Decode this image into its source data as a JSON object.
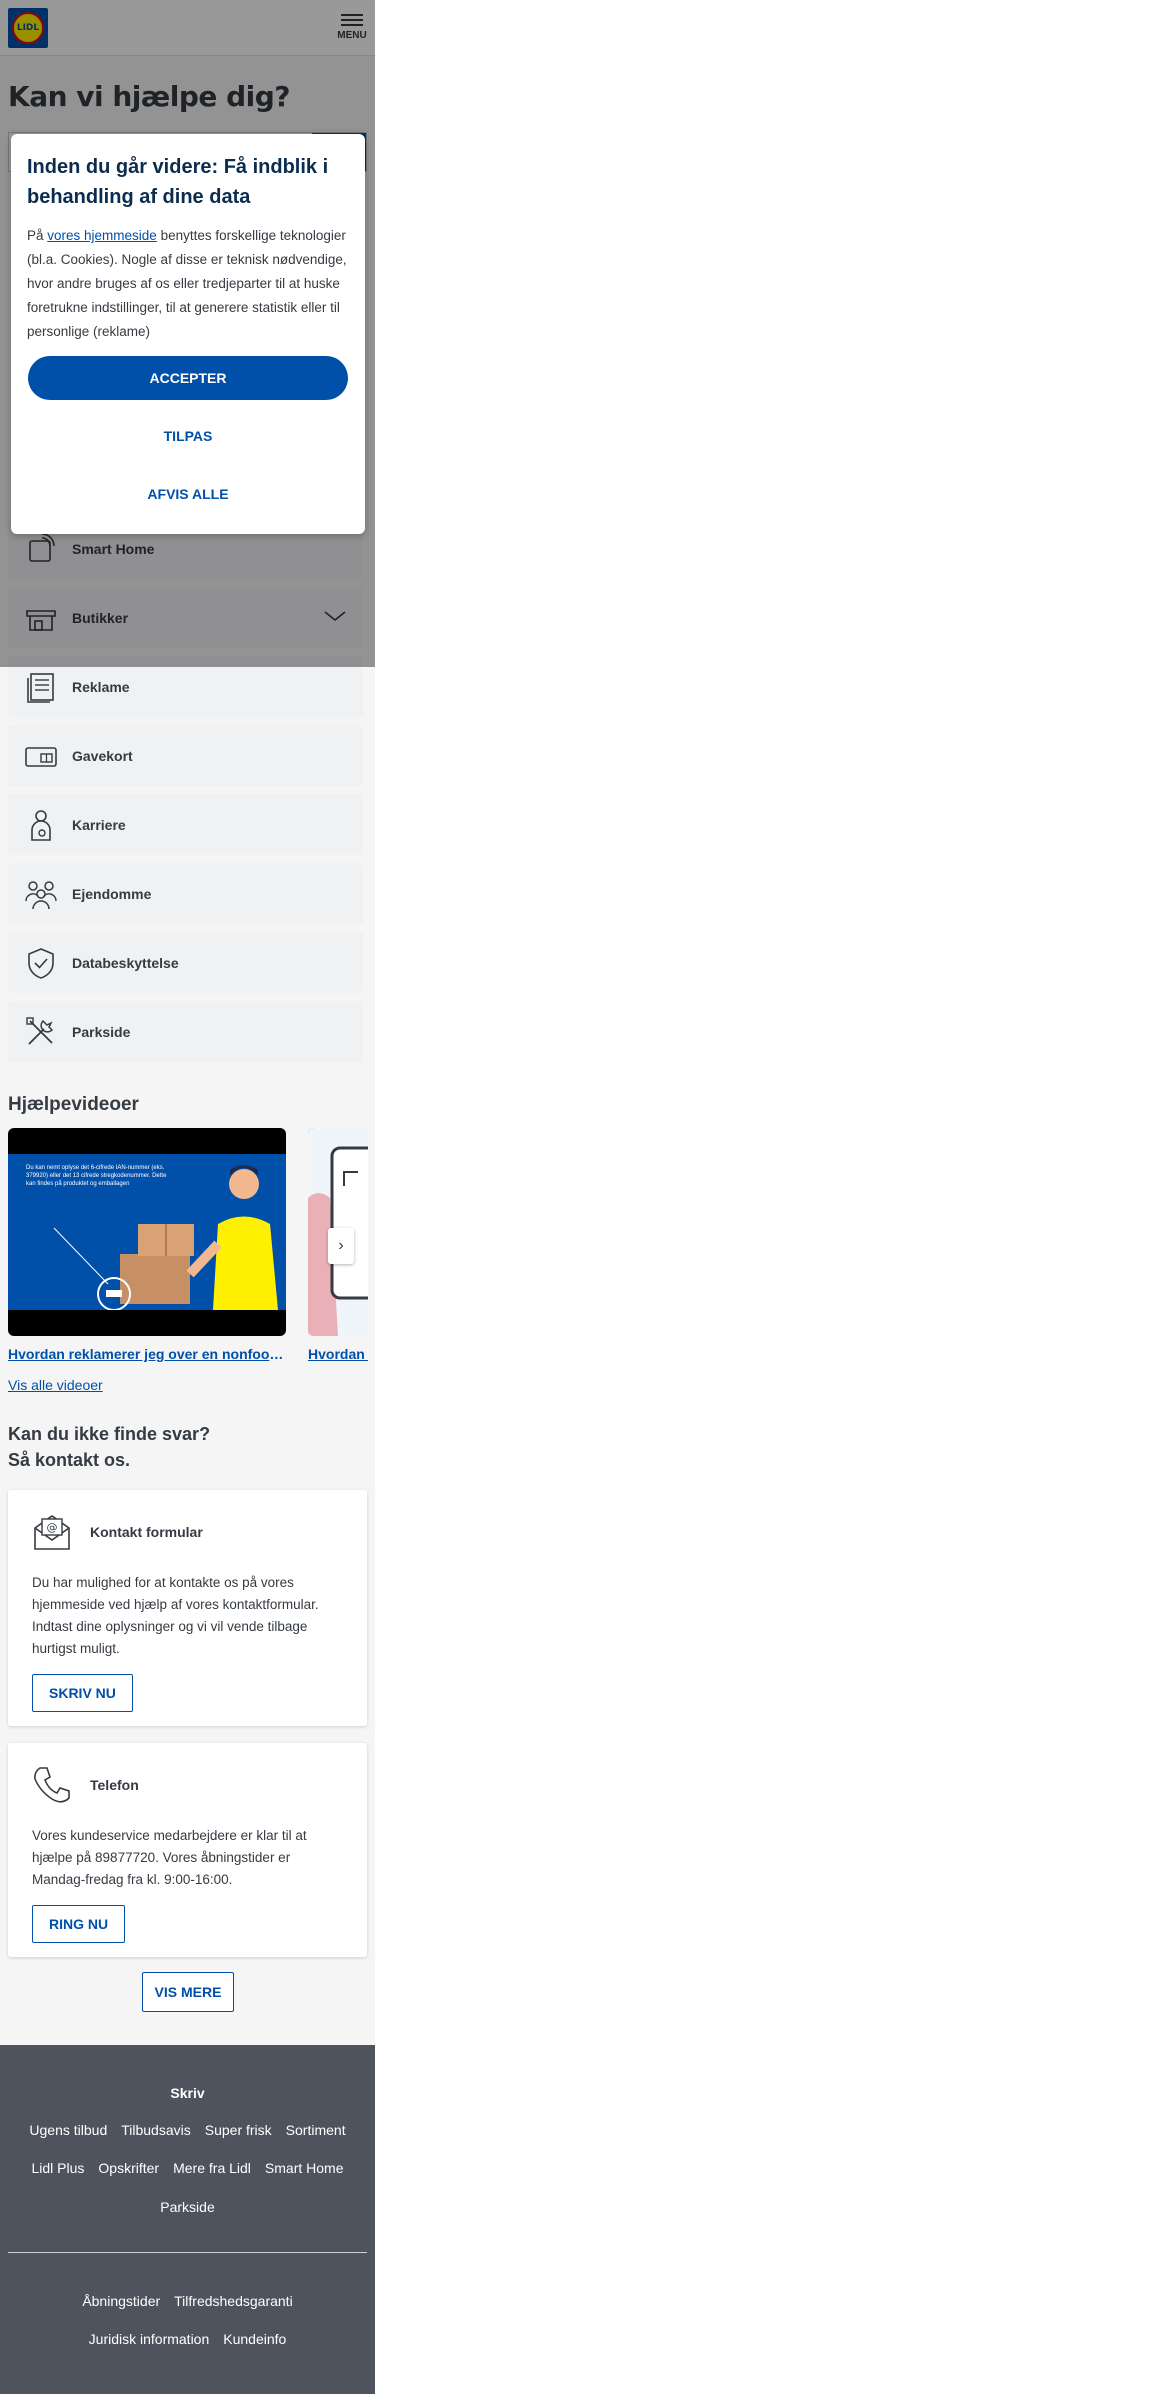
{
  "header": {
    "logo_text": "LIDL",
    "menu_label": "MENU"
  },
  "help": {
    "title": "Kan vi hjælpe dig?"
  },
  "categories": [
    {
      "label": "Smart Home",
      "icon": "smart-home-icon"
    },
    {
      "label": "Butikker",
      "icon": "store-icon"
    },
    {
      "label": "Reklame",
      "icon": "flyer-icon"
    },
    {
      "label": "Gavekort",
      "icon": "giftcard-icon"
    },
    {
      "label": "Karriere",
      "icon": "career-icon"
    },
    {
      "label": "Ejendomme",
      "icon": "people-icon"
    },
    {
      "label": "Databeskyttelse",
      "icon": "shield-icon"
    },
    {
      "label": "Parkside",
      "icon": "tools-icon"
    }
  ],
  "videos": {
    "heading": "Hjælpevideoer",
    "items": [
      {
        "title": "Hvordan reklamerer jeg over en nonfood vare?",
        "thumb_text": "Du kan nemt oplyse det 6-cifrede IAN-nummer (eks. 379920) eller det 13 cifrede stregkodenummer. Dette kan findes på produktet og emballagen"
      },
      {
        "title": "Hvordan kan jeg..."
      }
    ],
    "next_label": "›",
    "see_all": "Vis alle videoer"
  },
  "contact": {
    "heading_line1": "Kan du ikke finde svar?",
    "heading_line2": "Så kontakt os.",
    "form": {
      "title": "Kontakt formular",
      "body": "Du har mulighed for at kontakte os på vores hjemmeside ved hjælp af vores kontaktformular. Indtast dine oplysninger og vi vil vende tilbage hurtigst muligt.",
      "button": "SKRIV NU"
    },
    "phone": {
      "title": "Telefon",
      "body": "Vores kundeservice medarbejdere er klar til at hjælpe på 89877720. Vores åbningstider er Mandag-fredag fra kl. 9:00-16:00.",
      "button": "RING NU"
    },
    "more_button": "VIS MERE"
  },
  "footer": {
    "heading": "Skriv",
    "row1": [
      "Ugens tilbud",
      "Tilbudsavis",
      "Super frisk",
      "Sortiment"
    ],
    "row2": [
      "Lidl Plus",
      "Opskrifter",
      "Mere fra Lidl",
      "Smart Home"
    ],
    "row3": [
      "Parkside"
    ],
    "row4": [
      "Åbningstider",
      "Tilfredshedsgaranti"
    ],
    "row5": [
      "Juridisk information",
      "Kundeinfo"
    ]
  },
  "cookie": {
    "title": "Inden du går videre: Få indblik i behandling af dine data",
    "text_prefix": "På ",
    "text_link": "vores hjemmeside",
    "text_rest": " benyttes forskellige teknologier (bl.a. Cookies). Nogle af disse er teknisk nødvendige, hvor andre bruges af os eller tredjeparter til at huske foretrukne indstillinger, til at generere statistik eller til personlige (reklame)",
    "accept": "ACCEPTER",
    "customize": "TILPAS",
    "reject": "AFVIS ALLE"
  },
  "colors": {
    "brand_blue": "#0050aa",
    "footer_bg": "#4e535e",
    "yellow": "#fff000",
    "red": "#e60a14"
  }
}
